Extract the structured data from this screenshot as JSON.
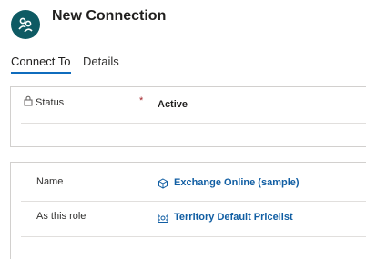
{
  "form": {
    "title": "New Connection"
  },
  "tabs": [
    {
      "label": "Connect To"
    },
    {
      "label": "Details"
    }
  ],
  "status": {
    "label": "Status",
    "required_marker": "*",
    "value": "Active"
  },
  "fields": {
    "name": {
      "label": "Name",
      "value": "Exchange Online (sample)",
      "icon": "cube-icon"
    },
    "role": {
      "label": "As this role",
      "value": "Territory Default Pricelist",
      "icon": "pricelist-icon"
    }
  },
  "colors": {
    "accent": "#0f6cbd",
    "avatar": "#0e5a63",
    "link": "#115ea3",
    "required": "#a4262c"
  }
}
